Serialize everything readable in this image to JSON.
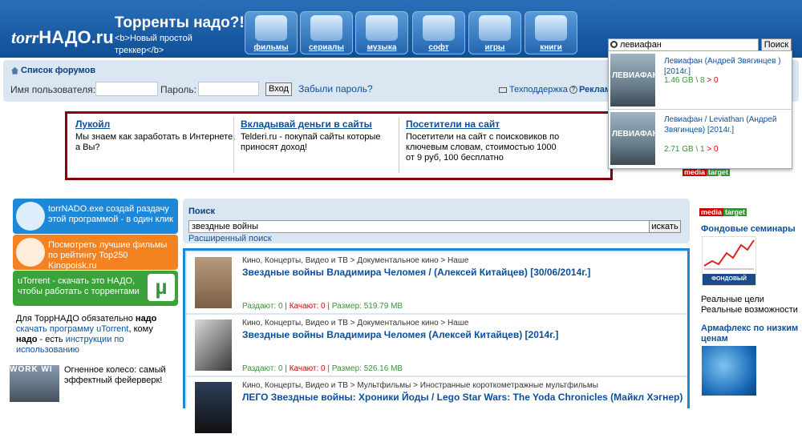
{
  "header": {
    "logo_a": "torr",
    "logo_b": "НАДО.ru",
    "slogan_title": "Торренты надо?!",
    "slogan_line1": "<b>Новый простой",
    "slogan_line2": "треккер</b>",
    "categories": [
      {
        "label": "фильмы",
        "icon": "film-reel-icon"
      },
      {
        "label": "сериалы",
        "icon": "tv-icon"
      },
      {
        "label": "музыка",
        "icon": "music-notes-icon"
      },
      {
        "label": "софт",
        "icon": "disc-icon"
      },
      {
        "label": "игры",
        "icon": "playing-cards-icon"
      },
      {
        "label": "книги",
        "icon": "book-icon"
      }
    ],
    "search_value": "левиафан",
    "search_button": "Поиск"
  },
  "suggestions": [
    {
      "thumb": "ЛЕВИАФАН",
      "title": "Левиафан (Андрей Звягинцев ) [2014г.]",
      "size": "1.46 GB",
      "seeds": "8",
      "arrow": ">",
      "leech": "0"
    },
    {
      "thumb": "ЛЕВИАФАН",
      "title": "Левиафан / Leviathan (Андрей Звягинцев) [2014г.]",
      "size": "2.71 GB",
      "seeds": "1",
      "arrow": ">",
      "leech": "0"
    }
  ],
  "nav": {
    "forums_label": "Список форумов",
    "username_label": "Имя пользователя:",
    "password_label": "Пароль:",
    "login_button": "Вход",
    "forgot_link": "Забыли пароль?",
    "support_link": "Техподдержка",
    "ads_link": "Реклама"
  },
  "ad_block": {
    "columns": [
      {
        "head": "Лукойл",
        "desc": "Мы знаем как заработать в Интернете, а Вы?"
      },
      {
        "head": "Вкладывай деньги в сайты",
        "desc": "Telderi.ru - покупай сайты которые приносят доход!"
      },
      {
        "head": "Посетители на сайт",
        "desc": "Посетители на сайт с поисковиков по ключевым словам, стоимостью 1000 от 9 руб, 100 бесплатно"
      }
    ],
    "tag_m": "media",
    "tag_t": "target"
  },
  "left": {
    "banners": [
      {
        "text": "torrNADO.exe создай раздачу этой программой - в один клик",
        "color": "#1e88d8"
      },
      {
        "text": "Посмотреть лучшие фильмы по рейтингу Top250 Kinopoisk.ru",
        "color": "#f58220"
      },
      {
        "text": "uTorrent - скачать это НАДО, чтобы работать с торрентами",
        "color": "#3aa43a",
        "badge": "µ"
      }
    ],
    "info_a": "Для ТоррНАДО обязательно ",
    "info_b": "надо",
    "info_c": "скачать программу uTorrent",
    "info_d": ", кому ",
    "info_e": "надо",
    "info_f": " - есть ",
    "info_g": "инструкции по использованию",
    "wheel_label": "WORK  WI",
    "wheel_text": "Огненное колесо: самый эффектный фейерверк!"
  },
  "search": {
    "title": "Поиск",
    "value": "звездные войны",
    "button": "искать",
    "advanced": "Расширенный поиск"
  },
  "results": [
    {
      "path": "Кино, Концерты, Видео и ТВ > Документальное кино > Наше",
      "title": "Звездные войны Владимира Челомея / (Алексей Китайцев) [30/06/2014г.]",
      "seed_label": "Раздают: 0",
      "leech_label": "Качают: 0",
      "size_label": "Размер: 519.79 MB",
      "sep": "|"
    },
    {
      "path": "Кино, Концерты, Видео и ТВ > Документальное кино > Наше",
      "title": "Звездные войны Владимира Челомея (Алексей Китайцев) [2014г.]",
      "seed_label": "Раздают: 0",
      "leech_label": "Качают: 0",
      "size_label": "Размер: 526.16 MB",
      "sep": "|"
    },
    {
      "path": "Кино, Концерты, Видео и ТВ > Мультфильмы > Иностранные короткометражные мультфильмы",
      "title": "ЛЕГО Звездные войны: Хроники Йоды / Lego Star Wars: The Yoda Chronicles (Майкл Хэгнер)",
      "seed_label": "",
      "leech_label": "",
      "size_label": "",
      "sep": ""
    }
  ],
  "right": {
    "tag_m": "media",
    "tag_t": "target",
    "ad1_head": "Фондовые семинары",
    "ad1_img": "ФОНДОВЫЙ РЫНОК",
    "ad1_text": "Реальные цели Реальные возможности",
    "ad2_head": "Армафлекс по низким ценам"
  }
}
